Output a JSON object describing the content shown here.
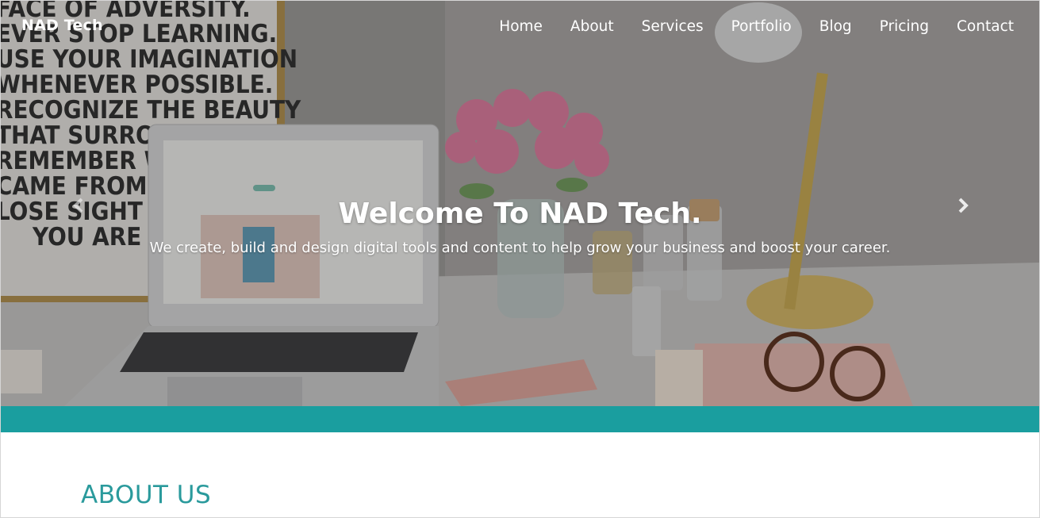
{
  "brand": "NAD Tech",
  "nav": {
    "items": [
      "Home",
      "About",
      "Services",
      "Portfolio",
      "Blog",
      "Pricing",
      "Contact"
    ]
  },
  "hero": {
    "title": "Welcome To NAD Tech.",
    "subtitle": "We create, build and design digital tools and content to help grow your business and boost your career.",
    "poster_lines": [
      "FACE OF ADVERSITY.",
      "EVER STOP LEARNING.",
      "USE YOUR IMAGINATION",
      "WHENEVER POSSIBLE.",
      "RECOGNIZE THE BEAUTY",
      "THAT SURROUNDS",
      "REMEMBER WHERE",
      "CAME FROM, BUT",
      "LOSE SIGHT OF",
      "YOU ARE GOING"
    ]
  },
  "about": {
    "heading": "ABOUT US"
  },
  "colors": {
    "accent": "#1a9e9f",
    "heading": "#2a9a9c"
  },
  "icons": {
    "prev": "chevron-left-icon",
    "next": "chevron-right-icon"
  }
}
